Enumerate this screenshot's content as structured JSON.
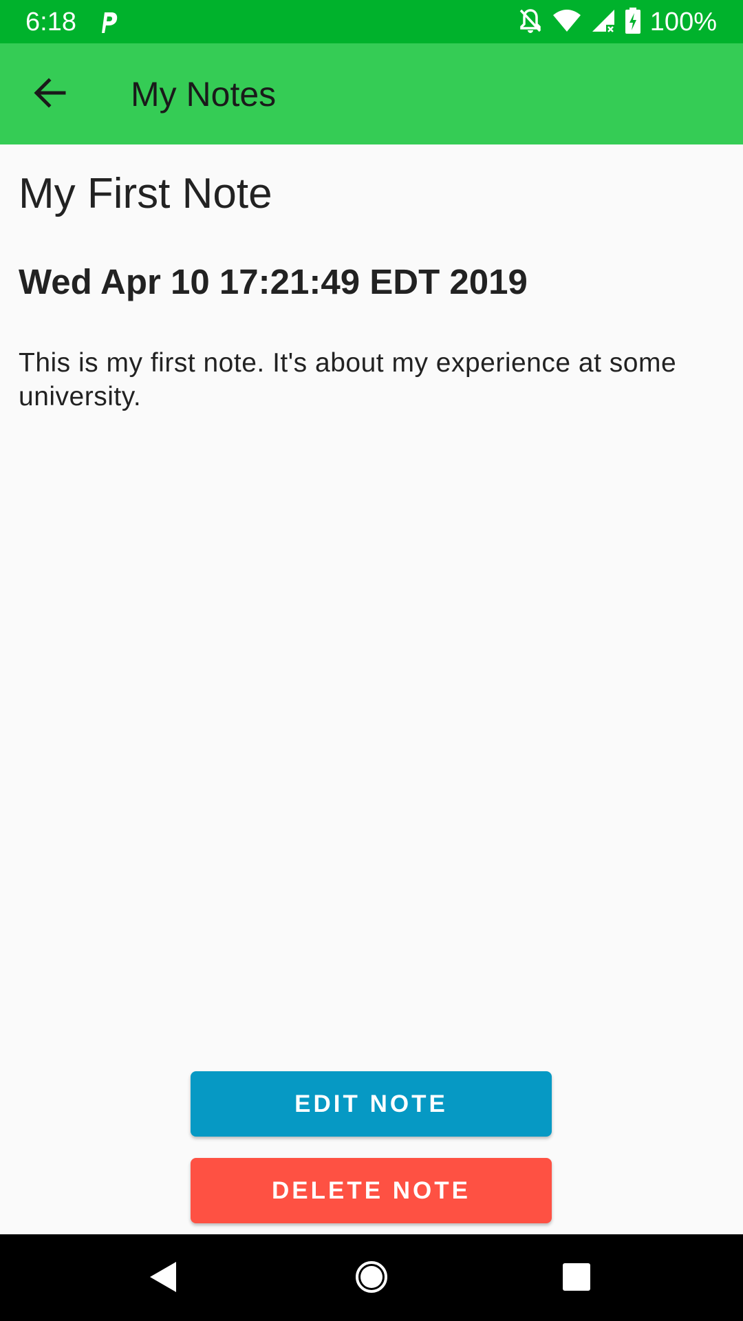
{
  "status_bar": {
    "time": "6:18",
    "battery_percent": "100%",
    "icons": [
      "parking-app-icon",
      "notifications-off-icon",
      "wifi-icon",
      "cellular-signal-icon",
      "battery-charging-icon"
    ],
    "background_color": "#00b22c"
  },
  "app_bar": {
    "title": "My Notes",
    "back_icon": "arrow-back-icon",
    "background_color": "#35cc55"
  },
  "note": {
    "title": "My First Note",
    "date": "Wed Apr 10 17:21:49 EDT 2019",
    "body": "This is my first note. It's about my experience at some university."
  },
  "actions": {
    "edit_label": "EDIT NOTE",
    "edit_color": "#0699c4",
    "delete_label": "DELETE NOTE",
    "delete_color": "#fe5143"
  },
  "nav_bar": {
    "icons": [
      "nav-back-icon",
      "nav-home-icon",
      "nav-recents-icon"
    ]
  }
}
